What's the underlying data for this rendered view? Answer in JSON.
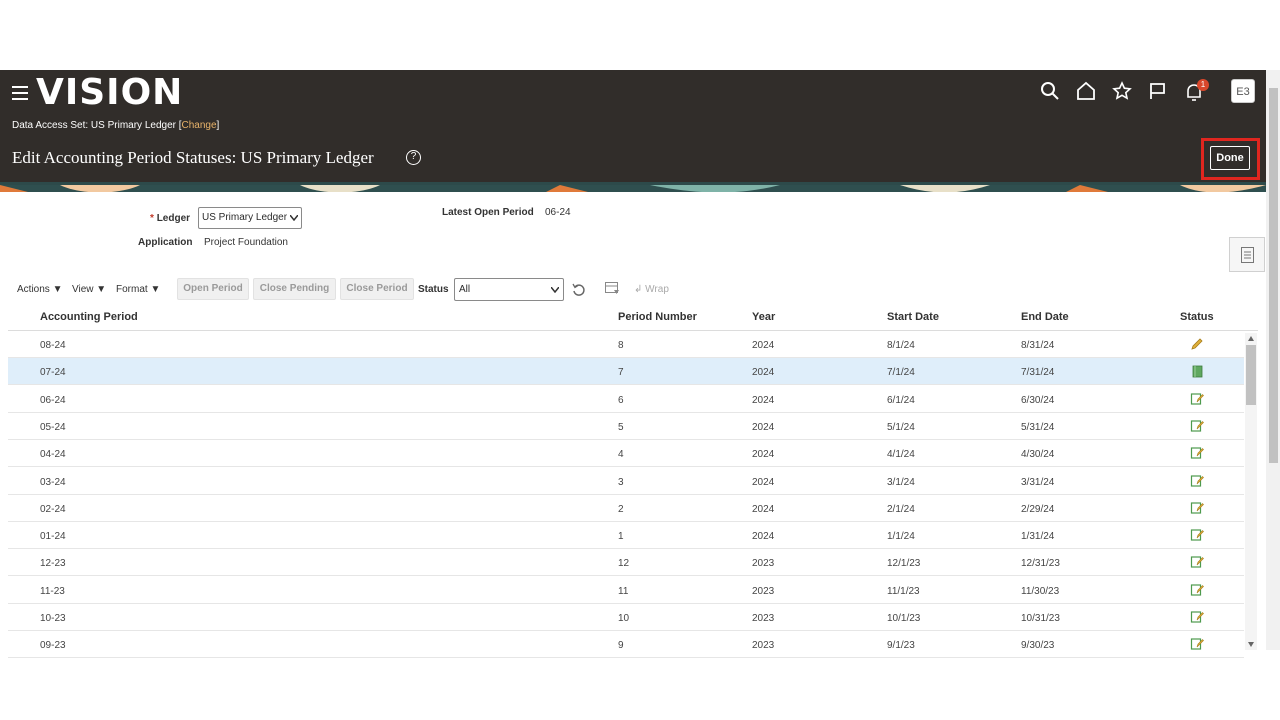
{
  "header": {
    "logo": "VISION",
    "data_access_label": "Data Access Set: US Primary Ledger [",
    "change_link": "Change",
    "data_access_close": "]",
    "page_title": "Edit Accounting Period Statuses: US Primary Ledger",
    "help": "?",
    "notification_count": "1",
    "avatar_initials": "E3",
    "done_label": "Done"
  },
  "form": {
    "ledger_label": "Ledger",
    "required_mark": "*",
    "ledger_value": "US Primary Ledger",
    "application_label": "Application",
    "application_value": "Project Foundation",
    "latest_open_label": "Latest Open Period",
    "latest_open_value": "06-24"
  },
  "toolbar": {
    "actions": "Actions",
    "view": "View",
    "format": "Format",
    "open_period": "Open Period",
    "close_pending": "Close Pending",
    "close_period": "Close Period",
    "status_label": "Status",
    "status_value": "All",
    "wrap": "Wrap"
  },
  "table": {
    "columns": [
      "Accounting Period",
      "Period Number",
      "Year",
      "Start Date",
      "End Date",
      "Status"
    ],
    "rows": [
      {
        "period": "08-24",
        "number": "8",
        "year": "2024",
        "start": "8/1/24",
        "end": "8/31/24",
        "status": "edit-pencil-icon"
      },
      {
        "period": "07-24",
        "number": "7",
        "year": "2024",
        "start": "7/1/24",
        "end": "7/31/24",
        "status": "open-book-icon"
      },
      {
        "period": "06-24",
        "number": "6",
        "year": "2024",
        "start": "6/1/24",
        "end": "6/30/24",
        "status": "edit-note-icon"
      },
      {
        "period": "05-24",
        "number": "5",
        "year": "2024",
        "start": "5/1/24",
        "end": "5/31/24",
        "status": "edit-note-icon"
      },
      {
        "period": "04-24",
        "number": "4",
        "year": "2024",
        "start": "4/1/24",
        "end": "4/30/24",
        "status": "edit-note-icon"
      },
      {
        "period": "03-24",
        "number": "3",
        "year": "2024",
        "start": "3/1/24",
        "end": "3/31/24",
        "status": "edit-note-icon"
      },
      {
        "period": "02-24",
        "number": "2",
        "year": "2024",
        "start": "2/1/24",
        "end": "2/29/24",
        "status": "edit-note-icon"
      },
      {
        "period": "01-24",
        "number": "1",
        "year": "2024",
        "start": "1/1/24",
        "end": "1/31/24",
        "status": "edit-note-icon"
      },
      {
        "period": "12-23",
        "number": "12",
        "year": "2023",
        "start": "12/1/23",
        "end": "12/31/23",
        "status": "edit-note-icon"
      },
      {
        "period": "11-23",
        "number": "11",
        "year": "2023",
        "start": "11/1/23",
        "end": "11/30/23",
        "status": "edit-note-icon"
      },
      {
        "period": "10-23",
        "number": "10",
        "year": "2023",
        "start": "10/1/23",
        "end": "10/31/23",
        "status": "edit-note-icon"
      },
      {
        "period": "09-23",
        "number": "9",
        "year": "2023",
        "start": "9/1/23",
        "end": "9/30/23",
        "status": "edit-note-icon"
      }
    ]
  },
  "colors": {
    "header_bg": "#312d2a",
    "selected_row": "#dfeefa",
    "highlight": "#e0261f"
  }
}
